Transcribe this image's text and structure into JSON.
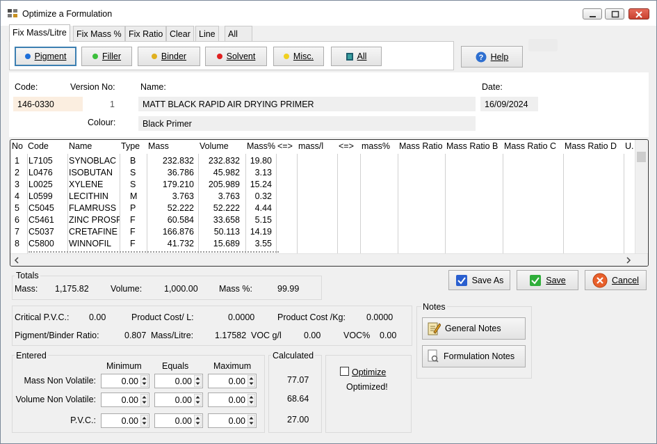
{
  "window": {
    "title": "Optimize a Formulation"
  },
  "tabs": [
    "Fix Mass/Litre",
    "Fix Mass %",
    "Fix Ratio",
    "Clear",
    "Line",
    "All"
  ],
  "filters": {
    "pigment": "Pigment",
    "filler": "Filler",
    "binder": "Binder",
    "solvent": "Solvent",
    "misc": "Misc.",
    "all": "All"
  },
  "help_label": "Help",
  "header": {
    "code_label": "Code:",
    "code": "146-0330",
    "version_label": "Version No:",
    "version": "1",
    "name_label": "Name:",
    "name": "MATT BLACK RAPID AIR DRYING PRIMER",
    "date_label": "Date:",
    "date": "16/09/2024",
    "colour_label": "Colour:",
    "colour": "Black Primer"
  },
  "grid": {
    "columns": [
      "No",
      "Code",
      "Name",
      "Type",
      "Mass",
      "Volume",
      "Mass%",
      "<=>",
      "mass/l",
      "<=>",
      "mass%",
      "Mass Ratio",
      "Mass Ratio B",
      "Mass Ratio C",
      "Mass Ratio D",
      "U."
    ],
    "rows": [
      [
        "1",
        "L7105",
        "SYNOBLAC",
        "B",
        "232.832",
        "232.832",
        "19.80"
      ],
      [
        "2",
        "L0476",
        "ISOBUTAN",
        "S",
        "36.786",
        "45.982",
        "3.13"
      ],
      [
        "3",
        "L0025",
        "XYLENE",
        "S",
        "179.210",
        "205.989",
        "15.24"
      ],
      [
        "4",
        "L0599",
        "LECITHIN",
        "M",
        "3.763",
        "3.763",
        "0.32"
      ],
      [
        "5",
        "C5045",
        "FLAMRUSS",
        "P",
        "52.222",
        "52.222",
        "4.44"
      ],
      [
        "6",
        "C5461",
        "ZINC PROSPH",
        "F",
        "60.584",
        "33.658",
        "5.15"
      ],
      [
        "7",
        "C5037",
        "CRETAFINE",
        "F",
        "166.876",
        "50.113",
        "14.19"
      ],
      [
        "8",
        "C5800",
        "WINNOFIL",
        "F",
        "41.732",
        "15.689",
        "3.55"
      ]
    ]
  },
  "totals": {
    "title": "Totals",
    "mass_label": "Mass:",
    "mass": "1,175.82",
    "volume_label": "Volume:",
    "volume": "1,000.00",
    "masspct_label": "Mass %:",
    "masspct": "99.99"
  },
  "actions": {
    "save_as": "Save As",
    "save": "Save",
    "cancel": "Cancel"
  },
  "stats": {
    "cpvc_label": "Critical P.V.C.:",
    "cpvc": "0.00",
    "cost_l_label": "Product Cost/ L:",
    "cost_l": "0.0000",
    "cost_kg_label": "Product Cost /Kg:",
    "cost_kg": "0.0000",
    "pb_label": "Pigment/Binder Ratio:",
    "pb": "0.807",
    "ml_label": "Mass/Litre:",
    "ml": "1.17582",
    "voc_label": "VOC g/l",
    "voc": "0.00",
    "vocpct_label": "VOC%",
    "vocpct": "0.00"
  },
  "notes": {
    "title": "Notes",
    "general": "General Notes",
    "formulation": "Formulation Notes"
  },
  "entered": {
    "title": "Entered",
    "min_label": "Minimum",
    "eq_label": "Equals",
    "max_label": "Maximum",
    "rows": [
      {
        "label": "Mass Non Volatile:",
        "min": "0.00",
        "eq": "0.00",
        "max": "0.00"
      },
      {
        "label": "Volume Non Volatile:",
        "min": "0.00",
        "eq": "0.00",
        "max": "0.00"
      },
      {
        "label": "P.V.C.:",
        "min": "0.00",
        "eq": "0.00",
        "max": "0.00"
      }
    ]
  },
  "calculated": {
    "title": "Calculated",
    "values": [
      "77.07",
      "68.64",
      "27.00"
    ]
  },
  "optimize": {
    "label": "Optimize",
    "status": "Optimized!"
  },
  "colors": {
    "pigment": "#1e6fd9",
    "filler": "#3cbf3c",
    "binder": "#e0b020",
    "solvent": "#e02020",
    "misc": "#f0d020",
    "all": "#2a8a8a"
  }
}
